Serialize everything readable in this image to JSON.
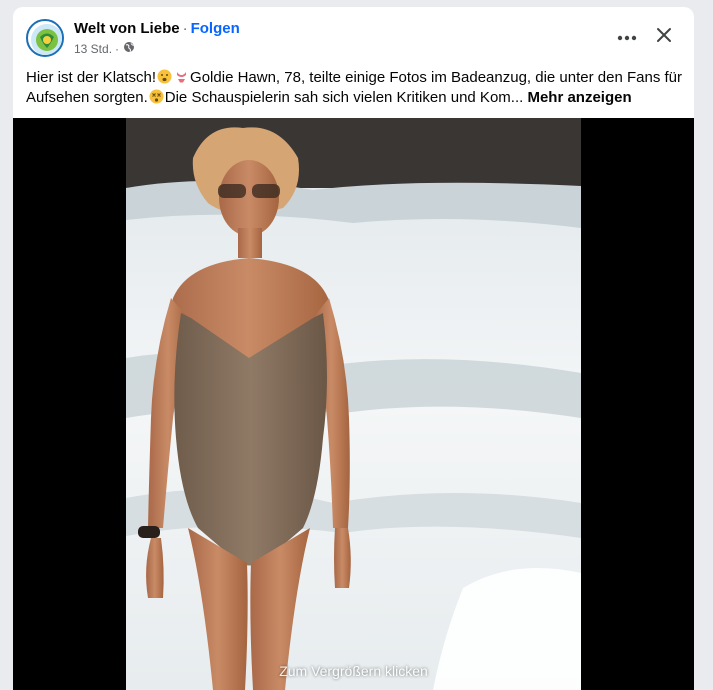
{
  "post": {
    "page_name": "Welt von Liebe",
    "separator": "·",
    "follow_label": "Folgen",
    "timestamp": "13 Std.",
    "meta_dot": "·",
    "privacy_icon": "globe-icon",
    "text_part1": "Hier ist der Klatsch!",
    "text_part2": "Goldie Hawn, 78, teilte einige Fotos im Badeanzug, die unter den Fans für Aufsehen sorgten.",
    "text_part3": "Die Schauspielerin sah sich vielen Kritiken und Kom...",
    "more_label": "Mehr anzeigen",
    "zoom_hint": "Zum Vergrößern klicken"
  },
  "icons": {
    "more": "more-horizontal-icon",
    "close": "close-icon",
    "emoji1": "sad-face-emoji-icon",
    "emoji2": "bikini-emoji-icon",
    "emoji3": "dizzy-face-emoji-icon"
  },
  "colors": {
    "link": "#0866ff",
    "text": "#050505",
    "secondary": "#65676b",
    "swimsuit": "#8b7560"
  }
}
